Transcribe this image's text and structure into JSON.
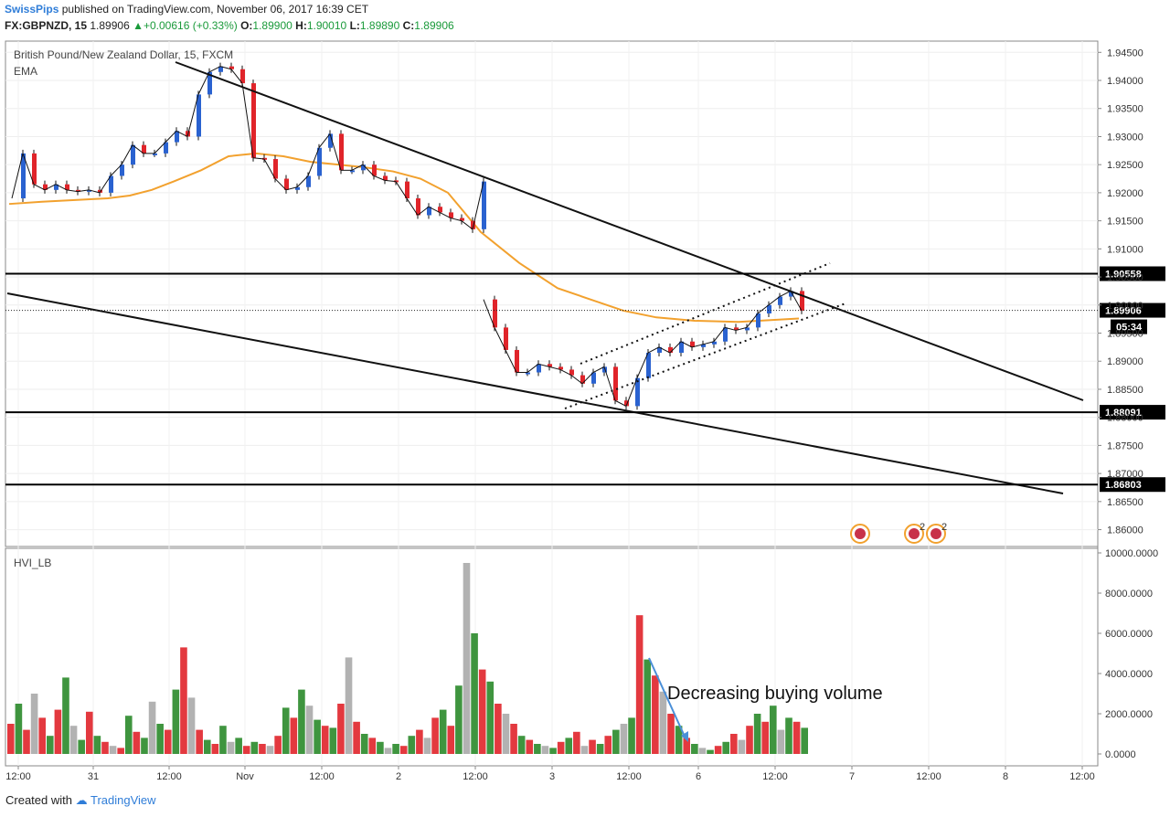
{
  "header": {
    "user": "SwissPips",
    "published": "published on TradingView.com, November 06, 2017 16:39 CET",
    "symbol_line": "FX:GBPNZD, 15",
    "last": "1.89906",
    "change": "+0.00616 (+0.33%)",
    "o_label": "O:",
    "o_value": "1.89900",
    "h_label": "H:",
    "h_value": "1.90010",
    "l_label": "L:",
    "l_value": "1.89890",
    "c_label": "C:",
    "c_value": "1.89906"
  },
  "footer": {
    "created_with": "Created with",
    "brand": "TradingView"
  },
  "colors": {
    "up": "#2a62d0",
    "down": "#e0242a",
    "ema": "#f2a12e",
    "vol_up": "#2a8a2a",
    "vol_down": "#e0242a",
    "vol_neutral": "#aaaaaa",
    "annotation_arrow": "#4a8fd8"
  },
  "chart_data": [
    {
      "type": "line",
      "title": "British Pound/New Zealand Dollar, 15, FXCM",
      "indicator": "EMA",
      "x_ticks": [
        "12:00",
        "31",
        "12:00",
        "Nov",
        "12:00",
        "2",
        "12:00",
        "3",
        "12:00",
        "6",
        "12:00",
        "7",
        "12:00",
        "8",
        "12:00"
      ],
      "y_ticks": [
        "1.94500",
        "1.94000",
        "1.93500",
        "1.93000",
        "1.92500",
        "1.92000",
        "1.91500",
        "1.91000",
        "1.90500",
        "1.90000",
        "1.89500",
        "1.89000",
        "1.88500",
        "1.88000",
        "1.87500",
        "1.87000",
        "1.86500",
        "1.86000"
      ],
      "ylim": [
        1.857,
        1.947
      ],
      "x": [
        0,
        4,
        8,
        12,
        16,
        20,
        24,
        28,
        32,
        36,
        40,
        44,
        48,
        52,
        56,
        60,
        64,
        68,
        72,
        76,
        80,
        84,
        88,
        92,
        96,
        100,
        104,
        108,
        112,
        116,
        120,
        124,
        128,
        132,
        136,
        140,
        144,
        148,
        152,
        156,
        160,
        164,
        168,
        172
      ],
      "price": [
        1.919,
        1.927,
        1.9215,
        1.9205,
        1.9215,
        1.9205,
        1.9202,
        1.9205,
        1.92,
        1.923,
        1.925,
        1.9285,
        1.927,
        1.927,
        1.929,
        1.931,
        1.93,
        1.9375,
        1.9415,
        1.9425,
        1.942,
        1.9395,
        1.9262,
        1.926,
        1.9225,
        1.9205,
        1.921,
        1.923,
        1.928,
        1.9305,
        1.924,
        1.924,
        1.925,
        1.923,
        1.9222,
        1.922,
        1.919,
        1.916,
        1.9175,
        1.9165,
        1.9155,
        1.915,
        1.9135,
        1.922
      ],
      "price2_x": [
        172,
        176,
        180,
        184,
        188,
        192,
        196,
        200,
        204,
        208,
        212,
        216,
        220,
        224,
        228,
        232,
        236,
        240,
        244,
        248,
        252,
        256,
        260,
        264,
        268,
        272,
        276,
        280,
        284,
        288
      ],
      "price2": [
        1.901,
        1.896,
        1.892,
        1.888,
        1.888,
        1.8895,
        1.889,
        1.8885,
        1.8875,
        1.886,
        1.888,
        1.889,
        1.883,
        1.882,
        1.887,
        1.8915,
        1.8925,
        1.8915,
        1.8935,
        1.8925,
        1.893,
        1.8935,
        1.896,
        1.8955,
        1.896,
        1.8985,
        1.9,
        1.9015,
        1.9025,
        1.899
      ],
      "ema": [
        1.918,
        1.9184,
        1.9187,
        1.919,
        1.9195,
        1.9205,
        1.922,
        1.924,
        1.9265,
        1.927,
        1.9265,
        1.9255,
        1.925,
        1.9245,
        1.9238,
        1.9225,
        1.92,
        1.913,
        1.9075,
        1.903,
        1.901,
        1.899,
        1.8978,
        1.8972,
        1.897,
        1.8976
      ],
      "ema_x": [
        0,
        12,
        24,
        36,
        44,
        52,
        60,
        70,
        80,
        90,
        100,
        110,
        120,
        130,
        140,
        150,
        160,
        172,
        186,
        200,
        212,
        224,
        236,
        250,
        266,
        288
      ],
      "levels": [
        {
          "value": 1.90558,
          "label": "1.90558"
        },
        {
          "value": 1.88091,
          "label": "1.88091"
        },
        {
          "value": 1.86803,
          "label": "1.86803"
        }
      ],
      "current_price": {
        "value": 1.89906,
        "label": "1.89906",
        "countdown": "05:34"
      }
    },
    {
      "type": "bar",
      "title": "HVI_LB",
      "y_ticks": [
        "10000.0000",
        "8000.0000",
        "6000.0000",
        "4000.0000",
        "2000.0000",
        "0.0000"
      ],
      "ylim": [
        0,
        10000
      ],
      "annotation": "Decreasing buying volume",
      "values": [
        1500,
        2500,
        1200,
        3000,
        1800,
        900,
        2200,
        3800,
        1400,
        700,
        2100,
        900,
        600,
        400,
        300,
        1900,
        1100,
        800,
        2600,
        1500,
        1200,
        3200,
        5300,
        2800,
        1200,
        700,
        500,
        1400,
        600,
        800,
        400,
        600,
        500,
        400,
        900,
        2300,
        1800,
        3200,
        2400,
        1700,
        1400,
        1300,
        2500,
        4800,
        1600,
        1000,
        800,
        600,
        300,
        500,
        400,
        900,
        1200,
        800,
        1800,
        2200,
        1400,
        3400,
        9500,
        6000,
        4200,
        3600,
        2500,
        2000,
        1500,
        900,
        700,
        500,
        400,
        300,
        600,
        800,
        1100,
        400,
        700,
        500,
        900,
        1200,
        1500,
        1800,
        6900,
        4700,
        3900,
        3100,
        2000,
        1400,
        800,
        500,
        300,
        200,
        400,
        600,
        1000,
        700,
        1400,
        2000,
        1600,
        2400,
        1200,
        1800,
        1600,
        1300
      ]
    }
  ]
}
